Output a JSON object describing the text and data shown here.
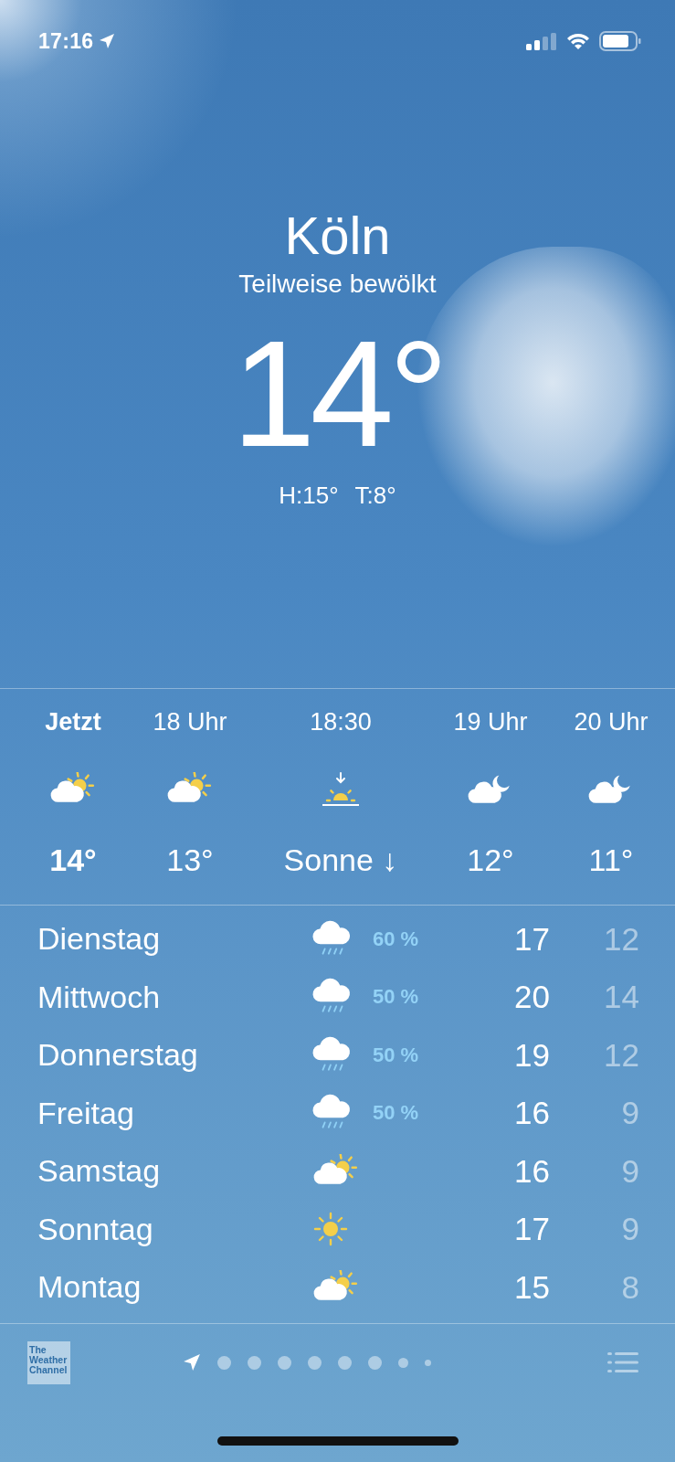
{
  "status_bar": {
    "time": "17:16",
    "location_active": true
  },
  "current": {
    "city": "Köln",
    "condition": "Teilweise bewölkt",
    "temperature": "14°",
    "high": "H:15°",
    "low": "T:8°"
  },
  "hourly": [
    {
      "label": "Jetzt",
      "kind": "partly_sunny",
      "value": "14°",
      "current": true
    },
    {
      "label": "18 Uhr",
      "kind": "partly_sunny",
      "value": "13°",
      "current": false
    },
    {
      "label": "18:30",
      "kind": "sunset",
      "value": "Sonne ↓",
      "current": false
    },
    {
      "label": "19 Uhr",
      "kind": "partly_moon",
      "value": "12°",
      "current": false
    },
    {
      "label": "20 Uhr",
      "kind": "partly_moon",
      "value": "11°",
      "current": false
    }
  ],
  "daily": [
    {
      "day": "Dienstag",
      "kind": "rain",
      "precipitation": "60 %",
      "high": "17",
      "low": "12"
    },
    {
      "day": "Mittwoch",
      "kind": "rain",
      "precipitation": "50 %",
      "high": "20",
      "low": "14"
    },
    {
      "day": "Donnerstag",
      "kind": "rain",
      "precipitation": "50 %",
      "high": "19",
      "low": "12"
    },
    {
      "day": "Freitag",
      "kind": "rain",
      "precipitation": "50 %",
      "high": "16",
      "low": "9"
    },
    {
      "day": "Samstag",
      "kind": "partly_sunny",
      "high": "16",
      "low": "9"
    },
    {
      "day": "Sonntag",
      "kind": "sunny",
      "high": "17",
      "low": "9"
    },
    {
      "day": "Montag",
      "kind": "partly_sunny",
      "high": "15",
      "low": "8"
    }
  ],
  "footer": {
    "provider_logo": "The Weather Channel",
    "pages": [
      {
        "kind": "location",
        "selected": true
      },
      {
        "kind": "dot",
        "selected": false
      },
      {
        "kind": "dot",
        "selected": false
      },
      {
        "kind": "dot",
        "selected": false
      },
      {
        "kind": "dot",
        "selected": false
      },
      {
        "kind": "dot",
        "selected": false
      },
      {
        "kind": "dot",
        "selected": false
      },
      {
        "kind": "dot",
        "selected": false
      },
      {
        "kind": "dot",
        "selected": false
      }
    ]
  }
}
